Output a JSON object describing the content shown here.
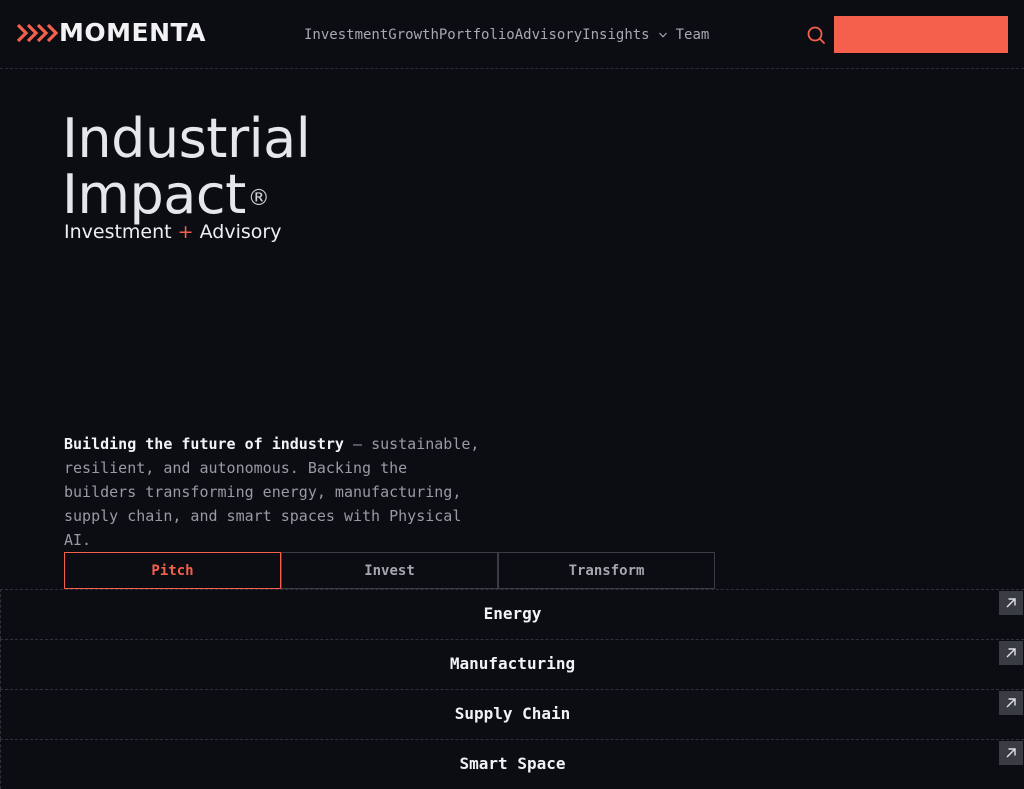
{
  "brand": {
    "name": "MOMENTA"
  },
  "nav": {
    "items": [
      "Investment",
      "Growth",
      "Portfolio",
      "Advisory",
      "Insights"
    ],
    "dropdown_icon": "chevron-down-icon",
    "after_dropdown": "Team"
  },
  "header": {
    "search_icon": "search-icon",
    "cta_label": ""
  },
  "hero": {
    "title_line1": "Industrial",
    "title_line2": "Impact",
    "title_mark": "®",
    "sub_left": "Investment",
    "sub_plus": "+",
    "sub_right": "Advisory"
  },
  "description": {
    "lead": "Building the future of industry",
    "dash": " — ",
    "body": "sustainable, resilient, and autonomous. Backing the builders transforming energy, manufacturing, supply chain, and smart spaces with Physical AI."
  },
  "tabs": [
    {
      "label": "Pitch",
      "active": true
    },
    {
      "label": "Invest",
      "active": false
    },
    {
      "label": "Transform",
      "active": false
    }
  ],
  "sectors": [
    {
      "label": "Energy"
    },
    {
      "label": "Manufacturing"
    },
    {
      "label": "Supply Chain"
    },
    {
      "label": "Smart Space"
    }
  ],
  "colors": {
    "accent": "#f4604b",
    "background": "#0b0d13",
    "text": "#e9eaee",
    "muted": "#989ba4"
  }
}
